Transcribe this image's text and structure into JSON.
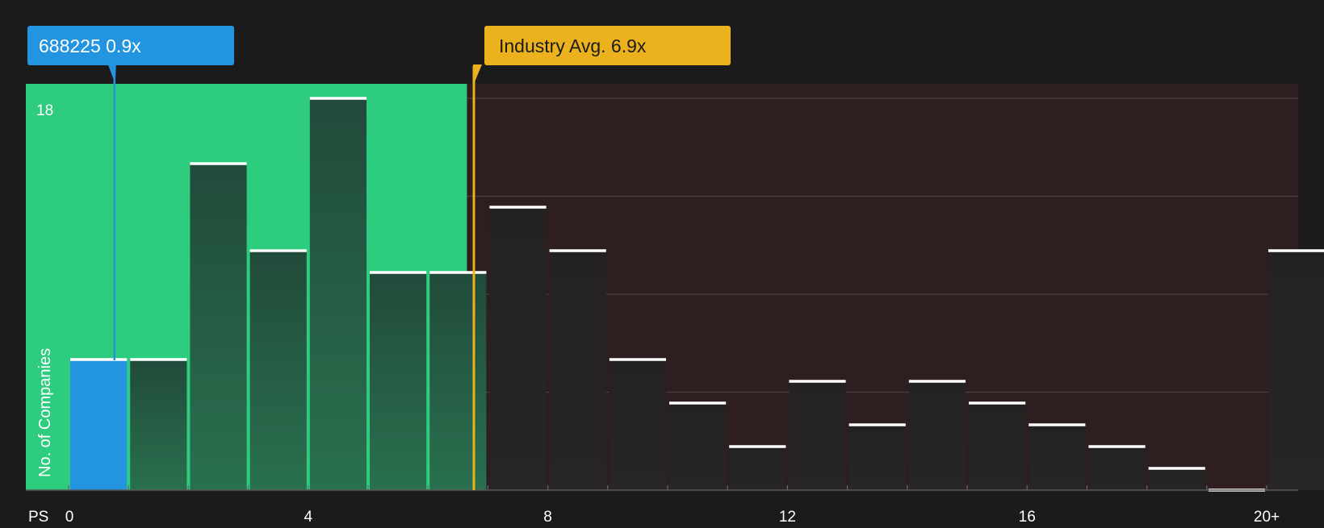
{
  "chart_data": {
    "type": "bar",
    "xlabel": "PS",
    "ylabel": "No. of Companies",
    "y_tick_label": "18",
    "x_tick_labels": [
      "0",
      "4",
      "8",
      "12",
      "16",
      "20+"
    ],
    "bins": [
      {
        "range": "0-1",
        "count": 6,
        "highlight": true
      },
      {
        "range": "1-2",
        "count": 6
      },
      {
        "range": "2-3",
        "count": 15
      },
      {
        "range": "3-4",
        "count": 11
      },
      {
        "range": "4-5",
        "count": 18
      },
      {
        "range": "5-6",
        "count": 10
      },
      {
        "range": "6-7",
        "count": 10
      },
      {
        "range": "7-8",
        "count": 13
      },
      {
        "range": "8-9",
        "count": 11
      },
      {
        "range": "9-10",
        "count": 6
      },
      {
        "range": "10-11",
        "count": 4
      },
      {
        "range": "11-12",
        "count": 2
      },
      {
        "range": "12-13",
        "count": 5
      },
      {
        "range": "13-14",
        "count": 3
      },
      {
        "range": "14-15",
        "count": 5
      },
      {
        "range": "15-16",
        "count": 4
      },
      {
        "range": "16-17",
        "count": 3
      },
      {
        "range": "17-18",
        "count": 2
      },
      {
        "range": "18-19",
        "count": 1
      },
      {
        "range": "19-20",
        "count": 0
      },
      {
        "range": "20+",
        "count": 11
      }
    ],
    "xlim": [
      0,
      20.5
    ],
    "ylim": [
      0,
      18
    ],
    "grid": true,
    "company": {
      "label": "688225 0.9x",
      "value": 0.9
    },
    "industry": {
      "label": "Industry Avg. 6.9x",
      "value": 6.9
    },
    "undervalued_zone_end": 6.65,
    "colors": {
      "background": "#1b1b1b",
      "undervalued_zone": "#2ecc7f",
      "overvalued_zone": "#2f1e1f",
      "company": "#2394e0",
      "industry": "#ecb21e",
      "bar_top": "#ffffff"
    }
  }
}
